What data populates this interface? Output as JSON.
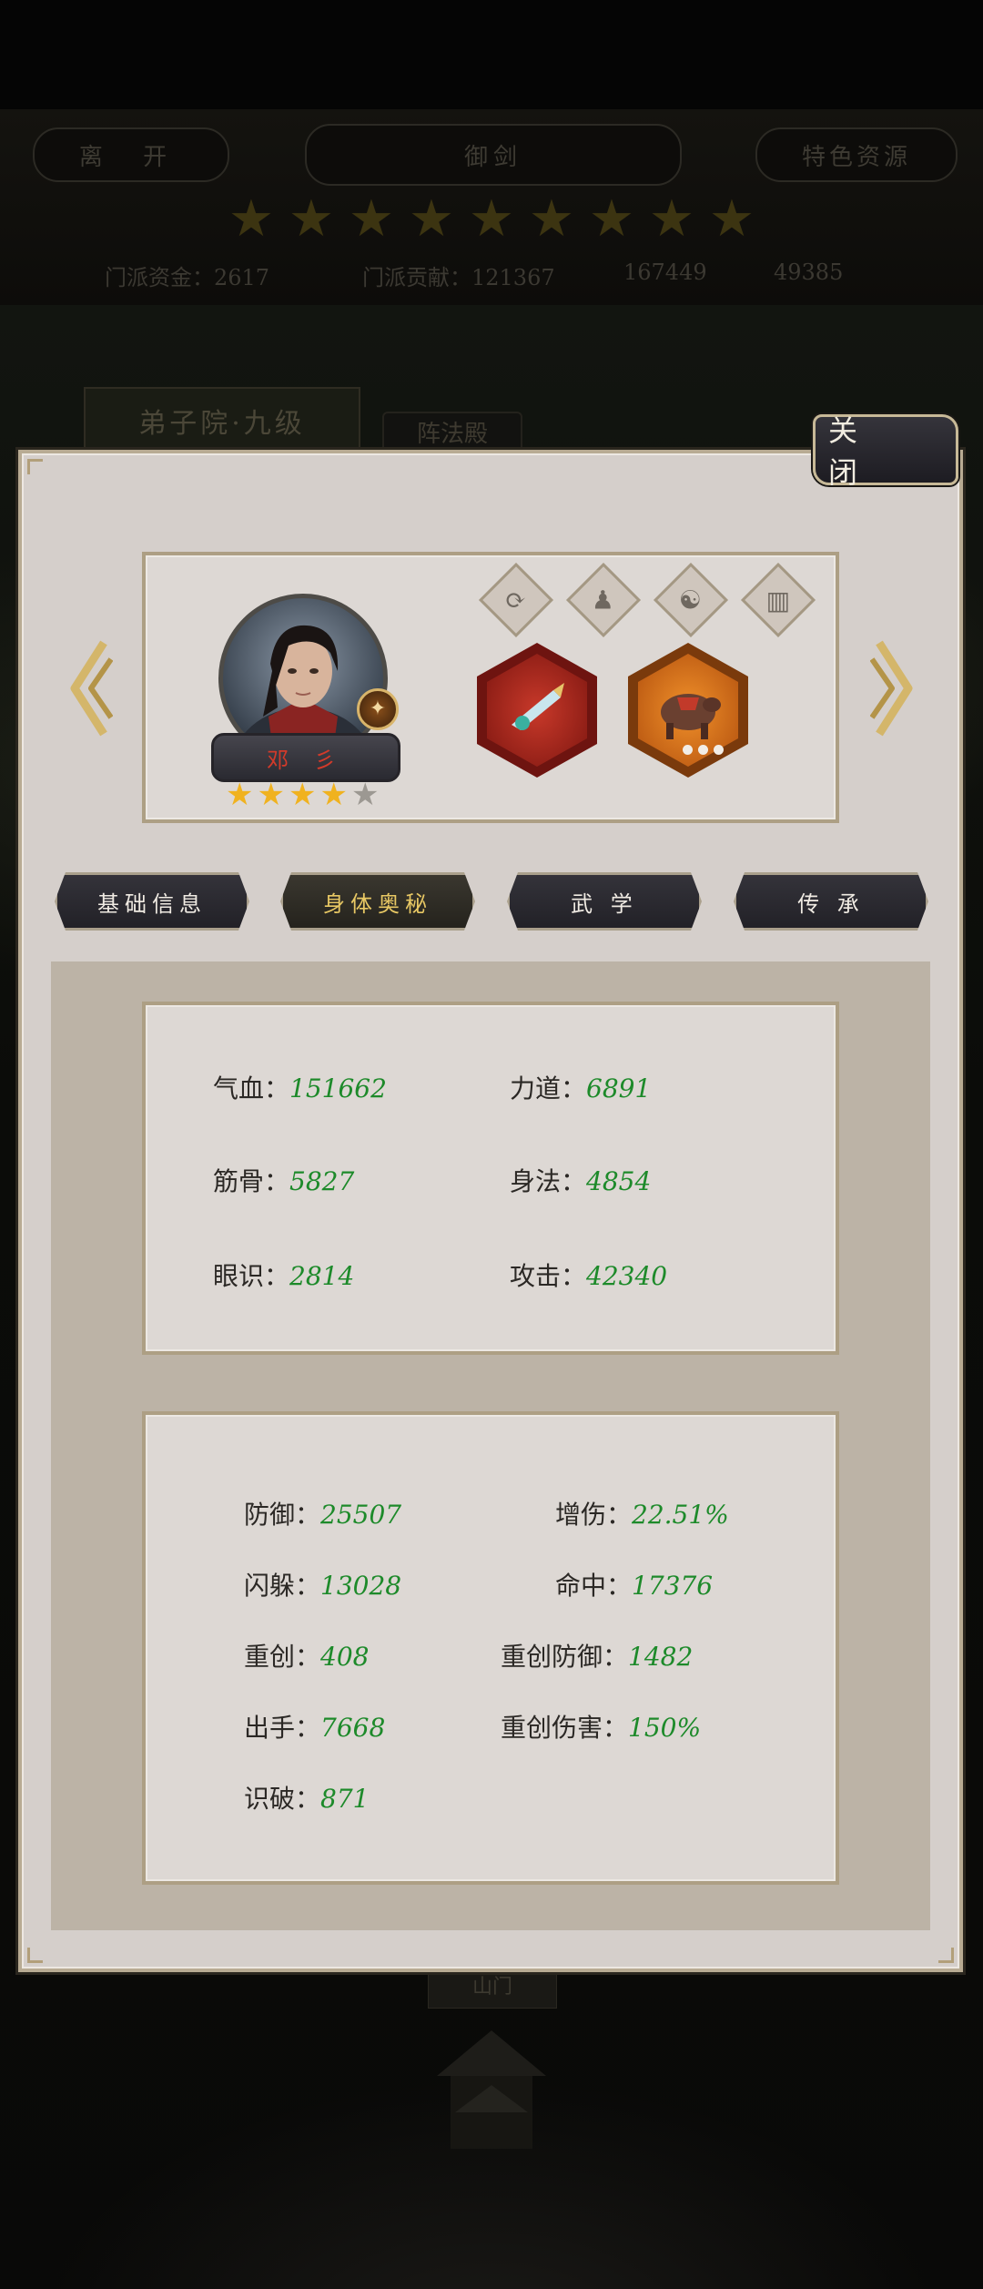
{
  "background": {
    "left_button": "离 开",
    "title": "御剑",
    "right_button": "特色资源",
    "star_count": 9,
    "stats": [
      "门派资金：2617",
      "门派贡献：121367",
      "167449",
      "49385"
    ],
    "tab_label": "弟子院·九级",
    "tab2_label": "阵法殿",
    "bottom_label": "山门"
  },
  "close_button": "关 闭",
  "hero": {
    "name": "邓 彡",
    "stars_filled": 4,
    "stars_total": 5,
    "skill_icons": [
      "refresh-icon",
      "person-icon",
      "yin-yang-icon",
      "book-icon"
    ],
    "equipment": [
      {
        "name": "weapon-item",
        "frame_color": "#b52418"
      },
      {
        "name": "mount-item",
        "frame_color": "#e0761a"
      }
    ]
  },
  "tabs": [
    {
      "label": "基础信息",
      "active": false
    },
    {
      "label": "身体奥秘",
      "active": true
    },
    {
      "label": "武 学",
      "active": false
    },
    {
      "label": "传 承",
      "active": false
    }
  ],
  "basic_stats": [
    {
      "label": "气血：",
      "value": "151662"
    },
    {
      "label": "力道：",
      "value": "6891"
    },
    {
      "label": "筋骨：",
      "value": "5827"
    },
    {
      "label": "身法：",
      "value": "4854"
    },
    {
      "label": "眼识：",
      "value": "2814"
    },
    {
      "label": "攻击：",
      "value": "42340"
    }
  ],
  "advanced_stats": [
    {
      "label": "防御：",
      "value": "25507"
    },
    {
      "label": "增伤：",
      "value": "22.51%"
    },
    {
      "label": "闪躲：",
      "value": "13028"
    },
    {
      "label": "命中：",
      "value": "17376"
    },
    {
      "label": "重创：",
      "value": "408"
    },
    {
      "label": "重创防御：",
      "value": "1482"
    },
    {
      "label": "出手：",
      "value": "7668"
    },
    {
      "label": "重创伤害：",
      "value": "150%"
    },
    {
      "label": "识破：",
      "value": "871"
    }
  ],
  "colors": {
    "stat_value": "#1d8a2a",
    "star_gold": "#f0b21f",
    "star_empty": "#9c9892",
    "name_red": "#d33a2a"
  }
}
